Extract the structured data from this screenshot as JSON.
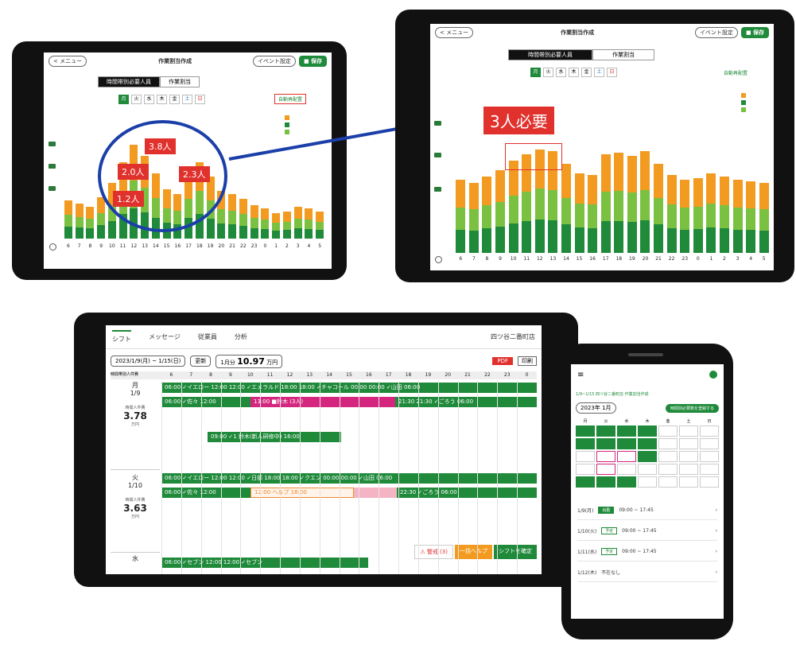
{
  "tablet_small": {
    "menu": "< メニュー",
    "title": "作業割当作成",
    "event": "イベント設定",
    "save": "■ 保存",
    "tab_required": "時間帯別必要人員",
    "tab_assign": "作業割当",
    "auto": "自動再配置",
    "days": [
      "月",
      "火",
      "水",
      "木",
      "金",
      "土",
      "日"
    ],
    "callouts": [
      "3.8人",
      "2.0人",
      "2.3人",
      "1.2人"
    ],
    "x": [
      "6",
      "7",
      "8",
      "9",
      "10",
      "11",
      "12",
      "13",
      "14",
      "15",
      "16",
      "17",
      "18",
      "19",
      "20",
      "21",
      "22",
      "23",
      "0",
      "1",
      "2",
      "3",
      "4",
      "5"
    ]
  },
  "tablet_big": {
    "menu": "< メニュー",
    "title": "作業割当作成",
    "event": "イベント設定",
    "save": "■ 保存",
    "tab_required": "時間帯別必要人員",
    "tab_assign": "作業割当",
    "auto": "自動再配置",
    "days": [
      "月",
      "火",
      "水",
      "木",
      "金",
      "土",
      "日"
    ],
    "callout": "3人必要",
    "x": [
      "6",
      "7",
      "8",
      "9",
      "10",
      "11",
      "12",
      "13",
      "14",
      "15",
      "16",
      "17",
      "18",
      "19",
      "20",
      "21",
      "22",
      "23",
      "0",
      "1",
      "2",
      "3",
      "4",
      "5"
    ]
  },
  "shift_tablet": {
    "nav": [
      "シフト",
      "メッセージ",
      "従業員",
      "分析"
    ],
    "store": "四ツ谷二番町店",
    "date_range": "2023/1/9(月) ~ 1/15(日)",
    "update": "更新",
    "month_label": "1月分",
    "hours": "10.97",
    "hours_unit": "万円",
    "pdf": "PDF",
    "print": "印刷",
    "col_label": "時間帯別人件費",
    "hours_axis": [
      "6",
      "7",
      "8",
      "9",
      "10",
      "11",
      "12",
      "13",
      "14",
      "15",
      "16",
      "17",
      "18",
      "19",
      "20",
      "21",
      "22",
      "23",
      "0"
    ],
    "day1": {
      "dow": "月",
      "date": "1/9",
      "lbl": "時間人件費",
      "val": "3.78",
      "unit": "万円"
    },
    "day2": {
      "dow": "火",
      "date": "1/10",
      "lbl": "時間人件費",
      "val": "3.63",
      "unit": "万円"
    },
    "day3": {
      "dow": "水"
    },
    "d1r1": "06:00 ✓イエロー 12:00 12:00 ✓エメラルド   18:00 18:00 ✓チャコール 00:00 00:00 ✓山田   06:00",
    "d1r2a": "06:00 ✓佐々  12:00",
    "d1r2b": "13:00 ■鈴木 (3人)",
    "d1r2c": "21:30 21:30 ✓ごろう   06:00",
    "d1r3": "09:00 ✓1 鈴木(新人研修中)  16:00",
    "d2r1": "06:00 ✓イエロー 12:00 12:00 ✓日部   18:00 18:00 ✓クエン 00:00 00:00 ✓山田   06:00",
    "d2r2a": "06:00 ✓佐々  12:00",
    "d2r2b": "12:00 ヘルプ  18:00",
    "d2r2c": "22:30 ✓ごろう   06:00",
    "d3r1": "06:00 ✓セブン  12:00 12:00 ✓セブン",
    "warn": "⚠ 警戒 (3)",
    "help": "一括ヘルプ",
    "confirm": "シフトを確定"
  },
  "phone": {
    "menu": "≡",
    "header": "1/9~1/15 四ツ谷二番町店 作業割当作成",
    "month": "2023年 1月",
    "action": "時間別必要数を登録する",
    "weekdays": [
      "月",
      "火",
      "水",
      "木",
      "金",
      "土",
      "日"
    ],
    "rows": [
      {
        "date": "1/9(月)",
        "tag": "出勤",
        "time": "09:00 ~ 17:45"
      },
      {
        "date": "1/10(火)",
        "tag": "予定",
        "time": "09:00 ~ 17:45"
      },
      {
        "date": "1/11(水)",
        "tag": "予定",
        "time": "09:00 ~ 17:45"
      },
      {
        "date": "1/12(木)",
        "tag": "",
        "time": "不在なし"
      }
    ]
  }
}
